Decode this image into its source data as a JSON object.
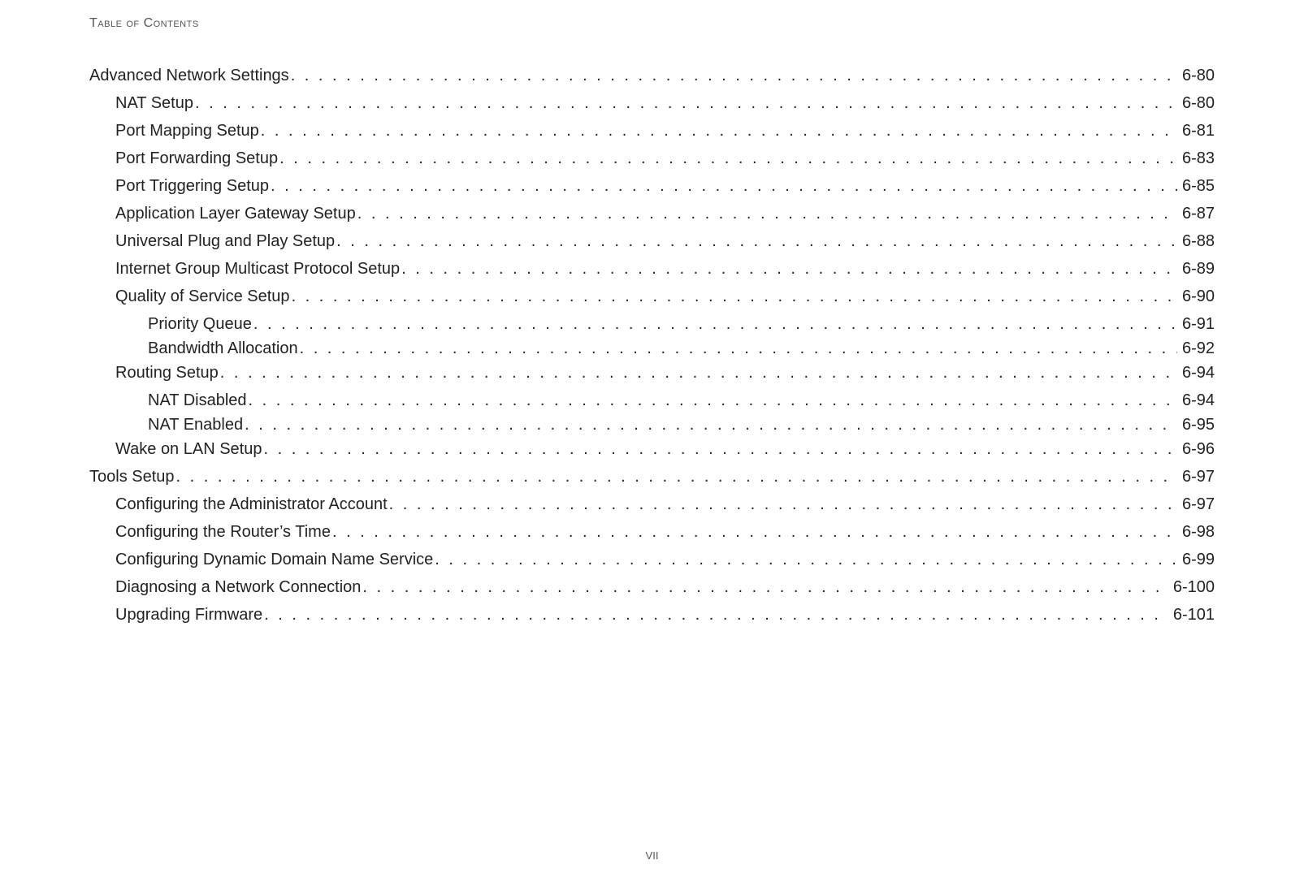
{
  "header": "Table of Contents",
  "footer_roman": "VII",
  "toc": [
    {
      "title": "Advanced Network Settings",
      "page": "6-80",
      "level": 0
    },
    {
      "title": "NAT Setup",
      "page": "6-80",
      "level": 1
    },
    {
      "title": "Port Mapping Setup",
      "page": "6-81",
      "level": 1
    },
    {
      "title": "Port Forwarding Setup",
      "page": "6-83",
      "level": 1
    },
    {
      "title": "Port Triggering Setup",
      "page": "6-85",
      "level": 1
    },
    {
      "title": "Application Layer Gateway Setup",
      "page": "6-87",
      "level": 1
    },
    {
      "title": "Universal Plug and Play Setup",
      "page": "6-88",
      "level": 1
    },
    {
      "title": "Internet Group Multicast Protocol Setup",
      "page": "6-89",
      "level": 1
    },
    {
      "title": "Quality of Service Setup",
      "page": "6-90",
      "level": 1
    },
    {
      "title": "Priority Queue",
      "page": "6-91",
      "level": 2
    },
    {
      "title": "Bandwidth Allocation",
      "page": "6-92",
      "level": 2
    },
    {
      "title": "Routing Setup",
      "page": "6-94",
      "level": 1
    },
    {
      "title": "NAT Disabled",
      "page": "6-94",
      "level": 2
    },
    {
      "title": "NAT Enabled",
      "page": "6-95",
      "level": 2
    },
    {
      "title": "Wake on LAN Setup",
      "page": "6-96",
      "level": 1
    },
    {
      "title": "Tools Setup",
      "page": "6-97",
      "level": 0
    },
    {
      "title": "Configuring the Administrator Account",
      "page": "6-97",
      "level": 1
    },
    {
      "title": "Configuring the Router’s Time",
      "page": "6-98",
      "level": 1
    },
    {
      "title": "Configuring Dynamic Domain Name Service",
      "page": "6-99",
      "level": 1
    },
    {
      "title": "Diagnosing a Network Connection",
      "page": "6-100",
      "level": 1
    },
    {
      "title": "Upgrading Firmware",
      "page": "6-101",
      "level": 1
    }
  ]
}
